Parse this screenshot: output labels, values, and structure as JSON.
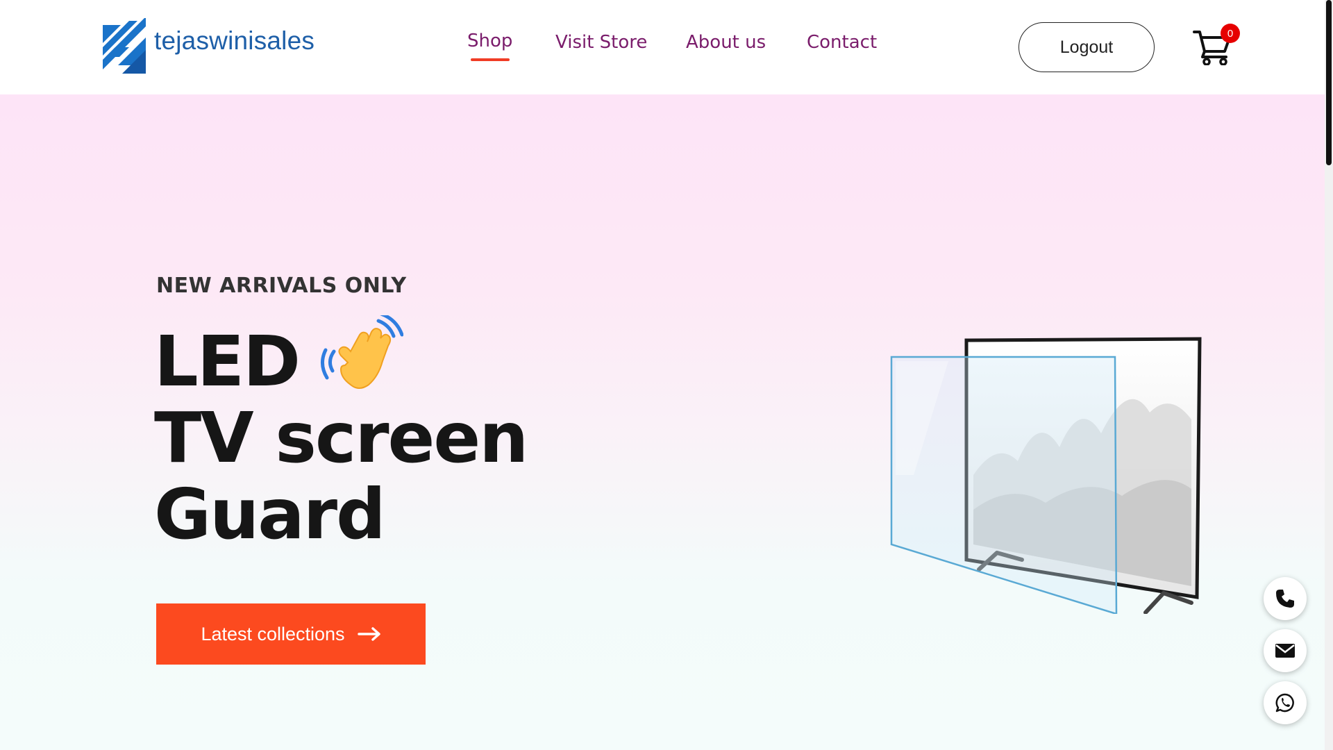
{
  "header": {
    "brand": "tejaswinisales",
    "nav": [
      {
        "label": "Shop",
        "active": true
      },
      {
        "label": "Visit Store",
        "active": false
      },
      {
        "label": "About us",
        "active": false
      },
      {
        "label": "Contact",
        "active": false
      }
    ],
    "logout_label": "Logout",
    "cart_count": "0",
    "icons": {
      "logo": "brand-logo-icon",
      "cart": "shopping-cart-icon"
    }
  },
  "hero": {
    "eyebrow": "NEW ARRIVALS ONLY",
    "headline_line1": "LED",
    "headline_line2": "TV screen",
    "headline_line3": "Guard",
    "cta_label": "Latest collections",
    "icons": {
      "wave": "waving-hand-icon",
      "cta": "arrow-right-icon",
      "product": "tv-screen-guard-image"
    }
  },
  "floating_contacts": [
    {
      "name": "phone-button",
      "icon": "phone-icon"
    },
    {
      "name": "email-button",
      "icon": "envelope-icon"
    },
    {
      "name": "whatsapp-button",
      "icon": "whatsapp-icon"
    }
  ],
  "colors": {
    "brand_blue": "#1e5fa8",
    "nav_purple": "#7a1c6b",
    "accent_orange": "#fc4a1f",
    "badge_red": "#e60000",
    "hero_top": "#fde4f7",
    "hero_bottom": "#f4fcfb"
  }
}
